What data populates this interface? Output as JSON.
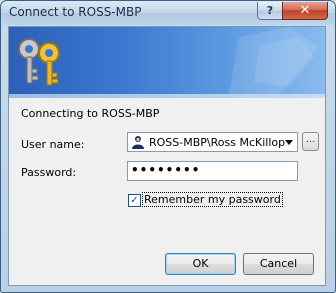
{
  "window": {
    "title": "Connect to ROSS-MBP",
    "help_glyph": "?",
    "close_glyph": "✕"
  },
  "banner": {
    "icon": "keys-icon",
    "colors": {
      "left": "#2d5fb8",
      "right": "#8bbbef"
    }
  },
  "form": {
    "connecting_text": "Connecting to ROSS-MBP",
    "username_label": "User name:",
    "username_value": "ROSS-MBP\\Ross McKillop",
    "browse_label": "...",
    "password_label": "Password:",
    "password_value": "••••••••",
    "remember_label": "Remember my password",
    "remember_checked": true,
    "check_glyph": "✓"
  },
  "buttons": {
    "ok_label": "OK",
    "cancel_label": "Cancel"
  }
}
